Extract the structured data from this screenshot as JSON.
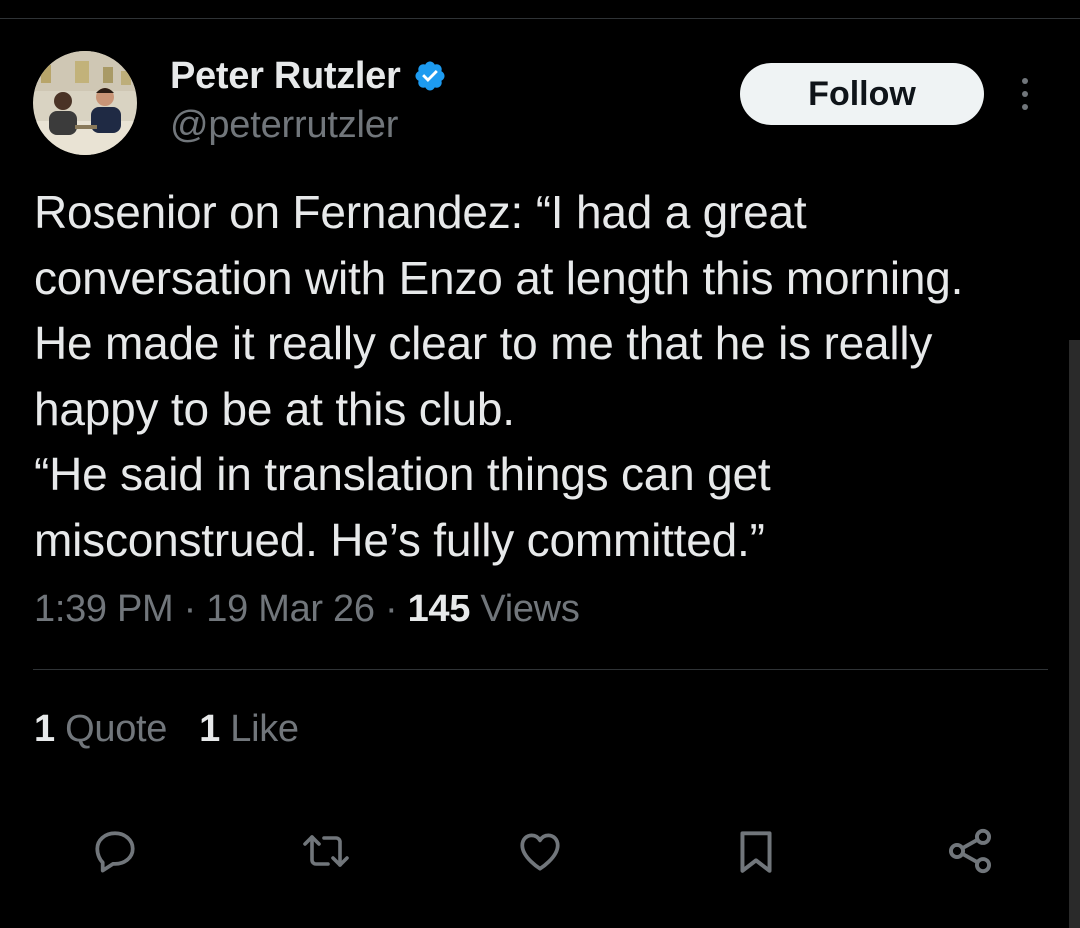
{
  "author": {
    "display_name": "Peter Rutzler",
    "handle": "@peterrutzler",
    "verified": true,
    "avatar_icon": "profile-photo"
  },
  "follow_label": "Follow",
  "tweet": {
    "paragraphs": [
      "Rosenior on Fernandez: “I had a great conversation with Enzo at length this morning. He made it really clear to me that he is really happy to be at this club.",
      "“He said in translation things can get misconstrued. He’s fully committed.”"
    ]
  },
  "meta": {
    "time": "1:39 PM",
    "sep1": " · ",
    "date": "19 Mar 26",
    "sep2": " · ",
    "views_count": "145",
    "views_label": " Views"
  },
  "stats": {
    "quotes_count": "1",
    "quotes_label": "Quote",
    "likes_count": "1",
    "likes_label": "Like"
  },
  "actions": [
    "reply-icon",
    "retweet-icon",
    "like-icon",
    "bookmark-icon",
    "share-icon"
  ],
  "colors": {
    "background": "#000000",
    "text_primary": "#e7e9ea",
    "text_secondary": "#71767b",
    "verified_blue": "#1d9bf0",
    "follow_bg": "#eff3f4",
    "divider": "#2f3336"
  }
}
